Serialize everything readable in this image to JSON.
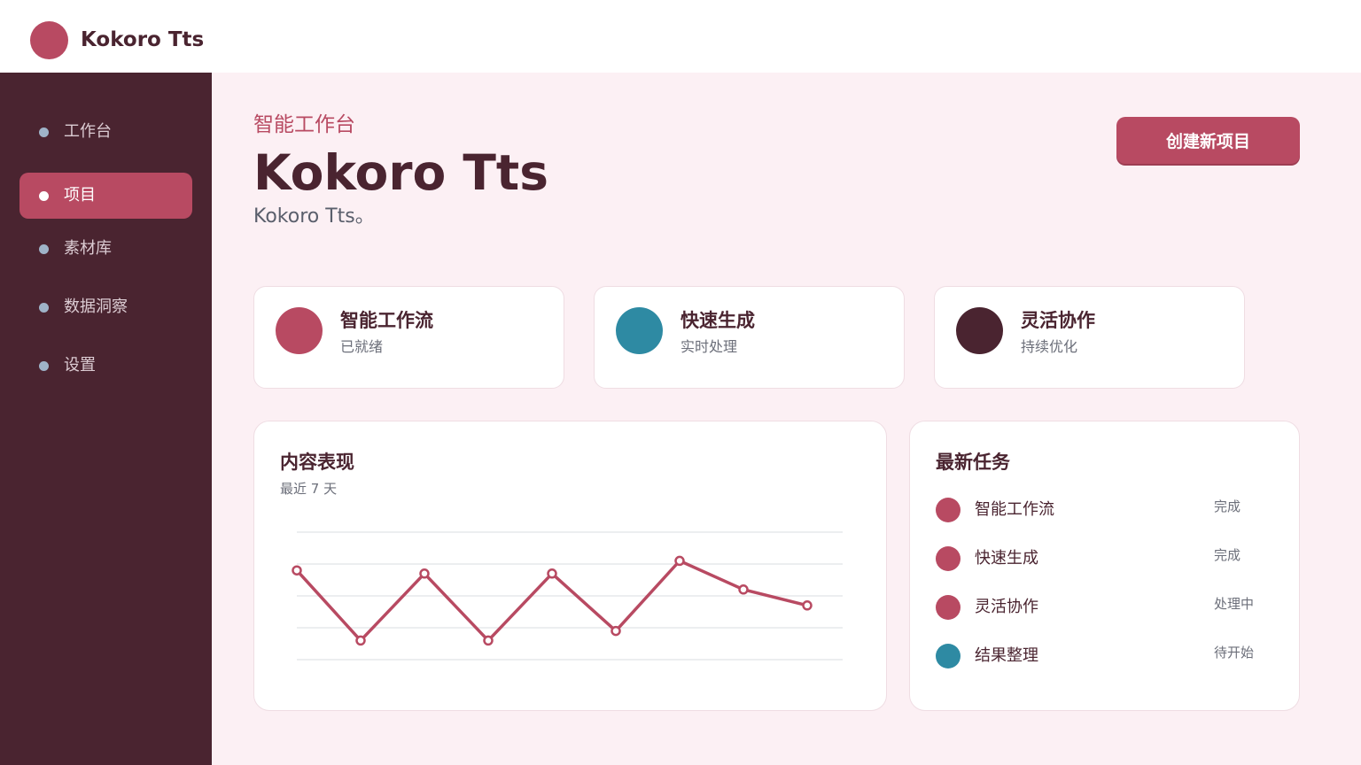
{
  "app": {
    "title": "Kokoro Tts"
  },
  "sidebar": {
    "items": [
      {
        "label": "工作台",
        "active": false
      },
      {
        "label": "项目",
        "active": true
      },
      {
        "label": "素材库",
        "active": false
      },
      {
        "label": "数据洞察",
        "active": false
      },
      {
        "label": "设置",
        "active": false
      }
    ]
  },
  "header": {
    "eyebrow": "智能工作台",
    "title": "Kokoro Tts",
    "description": "Kokoro Tts。",
    "cta_label": "创建新项目"
  },
  "features": [
    {
      "title": "智能工作流",
      "status": "已就绪",
      "color": "#b84a62"
    },
    {
      "title": "快速生成",
      "status": "实时处理",
      "color": "#2e8aa3"
    },
    {
      "title": "灵活协作",
      "status": "持续优化",
      "color": "#4a2430"
    }
  ],
  "performance": {
    "title": "内容表现",
    "subtitle": "最近 7 天"
  },
  "chart_data": {
    "type": "line",
    "title": "",
    "xlabel": "",
    "ylabel": "",
    "x": [
      1,
      2,
      3,
      4,
      5,
      6,
      7,
      8,
      9
    ],
    "series": [
      {
        "values": [
          68,
          46,
          67,
          46,
          67,
          49,
          71,
          62,
          57
        ],
        "color": "#b84a62"
      }
    ],
    "ylim": [
      40,
      80
    ],
    "grid": true,
    "axes_visible": false
  },
  "tasks": {
    "title": "最新任务",
    "items": [
      {
        "name": "智能工作流",
        "status": "完成",
        "color": "#b84a62"
      },
      {
        "name": "快速生成",
        "status": "完成",
        "color": "#b84a62"
      },
      {
        "name": "灵活协作",
        "status": "处理中",
        "color": "#b84a62"
      },
      {
        "name": "结果整理",
        "status": "待开始",
        "color": "#2e8aa3"
      }
    ]
  },
  "colors": {
    "accent": "#b84a62",
    "teal": "#2e8aa3",
    "dark": "#4a2430",
    "page_bg": "#fcf0f4"
  }
}
